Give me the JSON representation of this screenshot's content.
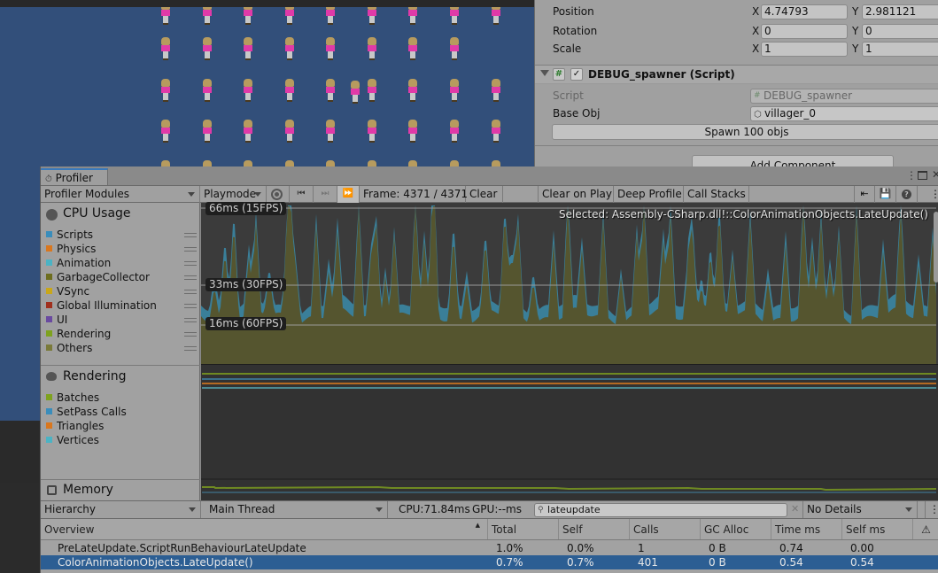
{
  "inspector": {
    "transform": {
      "position": {
        "label": "Position",
        "x": "4.74793",
        "y": "2.981121"
      },
      "rotation": {
        "label": "Rotation",
        "x": "0",
        "y": "0"
      },
      "scale": {
        "label": "Scale",
        "x": "1",
        "y": "1"
      },
      "axis_x": "X",
      "axis_y": "Y"
    },
    "component": {
      "title": "DEBUG_spawner (Script)",
      "enabled": true,
      "script_label": "Script",
      "script_value": "DEBUG_spawner",
      "base_obj_label": "Base Obj",
      "base_obj_value": "villager_0",
      "spawn_button": "Spawn 100 objs"
    },
    "add_component_button": "Add Component"
  },
  "profiler": {
    "tab_title": "Profiler",
    "toolbar": {
      "modules_dropdown": "Profiler Modules",
      "target_dropdown": "Playmode",
      "frame_label": "Frame: 4371 / 4371",
      "clear": "Clear",
      "clear_on_play": "Clear on Play",
      "deep_profile": "Deep Profile",
      "call_stacks": "Call Stacks"
    },
    "modules": {
      "cpu": {
        "title": "CPU Usage",
        "items": [
          {
            "label": "Scripts",
            "color": "#3a8dbb"
          },
          {
            "label": "Physics",
            "color": "#d9771e"
          },
          {
            "label": "Animation",
            "color": "#4bb3c4"
          },
          {
            "label": "GarbageCollector",
            "color": "#6d6d1e"
          },
          {
            "label": "VSync",
            "color": "#c9a71a"
          },
          {
            "label": "Global Illumination",
            "color": "#a0301e"
          },
          {
            "label": "UI",
            "color": "#6a4aa0"
          },
          {
            "label": "Rendering",
            "color": "#7ea21e"
          },
          {
            "label": "Others",
            "color": "#7a7a3a"
          }
        ]
      },
      "rendering": {
        "title": "Rendering",
        "items": [
          {
            "label": "Batches",
            "color": "#7ea21e"
          },
          {
            "label": "SetPass Calls",
            "color": "#3a8dbb"
          },
          {
            "label": "Triangles",
            "color": "#d9771e"
          },
          {
            "label": "Vertices",
            "color": "#4bb3c4"
          }
        ]
      },
      "memory": {
        "title": "Memory"
      }
    },
    "chart": {
      "labels": [
        "66ms (15FPS)",
        "33ms (30FPS)",
        "16ms (60FPS)"
      ],
      "selected": "Selected: Assembly-CSharp.dll!::ColorAnimationObjects.LateUpdate()"
    },
    "details": {
      "view_dropdown": "Hierarchy",
      "thread_dropdown": "Main Thread",
      "cpu_time": "CPU:71.84ms",
      "gpu_time": "GPU:--ms",
      "search_value": "lateupdate",
      "details_dropdown": "No Details",
      "columns": [
        "Overview",
        "Total",
        "Self",
        "Calls",
        "GC Alloc",
        "Time ms",
        "Self ms"
      ],
      "rows": [
        {
          "name": "PreLateUpdate.ScriptRunBehaviourLateUpdate",
          "total": "1.0%",
          "self": "0.0%",
          "calls": "1",
          "gc": "0 B",
          "time": "0.74",
          "selfms": "0.00",
          "selected": false
        },
        {
          "name": "ColorAnimationObjects.LateUpdate()",
          "total": "0.7%",
          "self": "0.7%",
          "calls": "401",
          "gc": "0 B",
          "time": "0.54",
          "selfms": "0.54",
          "selected": true
        }
      ]
    }
  },
  "colors": {
    "scene_bg": "#324f7a",
    "selection": "#2c5e93",
    "cpu_fill_others": "#55552f",
    "cpu_fill_scripts": "#3a7f99"
  }
}
